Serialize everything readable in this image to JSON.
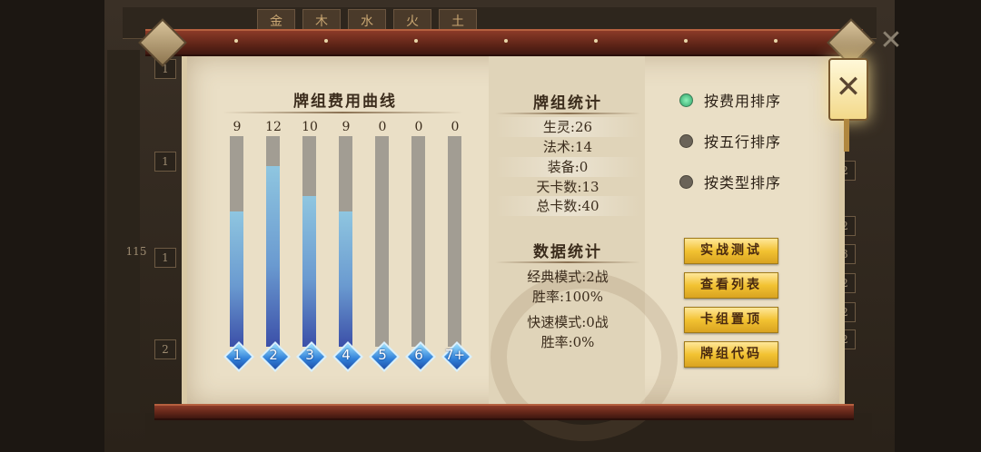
{
  "background": {
    "tabs": [
      "金",
      "木",
      "水",
      "火",
      "土"
    ],
    "left_numbers": [
      "1",
      "1",
      "2",
      "1",
      "115"
    ],
    "right_numbers": [
      "2",
      "2",
      "3",
      "2",
      "2",
      "2"
    ]
  },
  "cost_curve": {
    "title": "牌组费用曲线",
    "max": 12,
    "bars": [
      {
        "cost": "1",
        "count": 9
      },
      {
        "cost": "2",
        "count": 12
      },
      {
        "cost": "3",
        "count": 10
      },
      {
        "cost": "4",
        "count": 9
      },
      {
        "cost": "5",
        "count": 0
      },
      {
        "cost": "6",
        "count": 0
      },
      {
        "cost": "7+",
        "count": 0
      }
    ]
  },
  "deck_stats": {
    "title": "牌组统计",
    "lines": [
      "生灵:26",
      "法术:14",
      "装备:0",
      "天卡数:13",
      "总卡数:40"
    ]
  },
  "data_stats": {
    "title": "数据统计",
    "lines": [
      "经典模式:2战",
      "胜率:100%",
      "快速模式:0战",
      "胜率:0%"
    ]
  },
  "sort_options": [
    {
      "label": "按费用排序",
      "selected": true
    },
    {
      "label": "按五行排序",
      "selected": false
    },
    {
      "label": "按类型排序",
      "selected": false
    }
  ],
  "buttons": {
    "test": "实战测试",
    "view_list": "查看列表",
    "pin": "卡组置顶",
    "code": "牌组代码"
  },
  "close_label": "✕",
  "chart_data": {
    "type": "bar",
    "title": "牌组费用曲线",
    "categories": [
      "1",
      "2",
      "3",
      "4",
      "5",
      "6",
      "7+"
    ],
    "values": [
      9,
      12,
      10,
      9,
      0,
      0,
      0
    ],
    "ylim": [
      0,
      12
    ]
  }
}
